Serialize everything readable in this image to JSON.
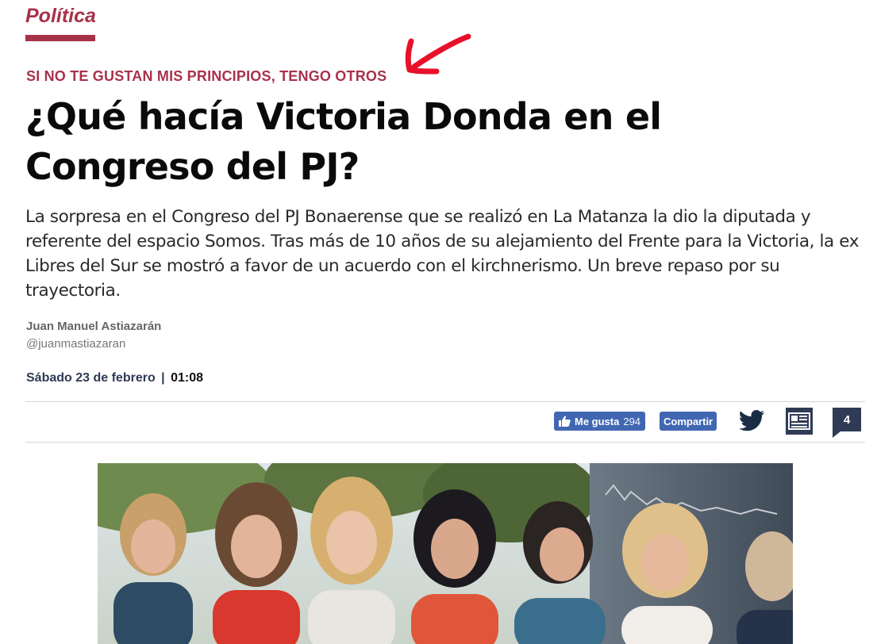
{
  "article": {
    "section": "Política",
    "kicker": "SI NO TE GUSTAN MIS PRINCIPIOS, TENGO OTROS",
    "headline": "¿Qué hacía Victoria Donda en el Congreso del PJ?",
    "summary": "La sorpresa en el Congreso del PJ Bonaerense que se realizó en La Matanza la dio la diputada y referente del espacio Somos. Tras más de 10 años de su alejamiento del Frente para la Victoria, la ex Libres del Sur se mostró a favor de un acuerdo con el kirchnerismo. Un breve repaso por su trayectoria.",
    "author_name": "Juan Manuel Astiazarán",
    "author_handle": "@juanmastiazaran",
    "date": "Sábado 23 de febrero",
    "date_separator": "|",
    "time": "01:08"
  },
  "share_bar": {
    "like_label": "Me gusta",
    "like_count": "294",
    "share_label": "Compartir",
    "twitter_icon": "twitter-bird-icon",
    "news_icon": "newspaper-icon",
    "comments_count": "4"
  },
  "colors": {
    "accent": "#a8324a",
    "facebook": "#4267b2",
    "navy": "#2f3a55",
    "twitter": "#1b2d45",
    "annotation_arrow": "#e8102a"
  },
  "photo": {
    "icon": "article-photo"
  }
}
